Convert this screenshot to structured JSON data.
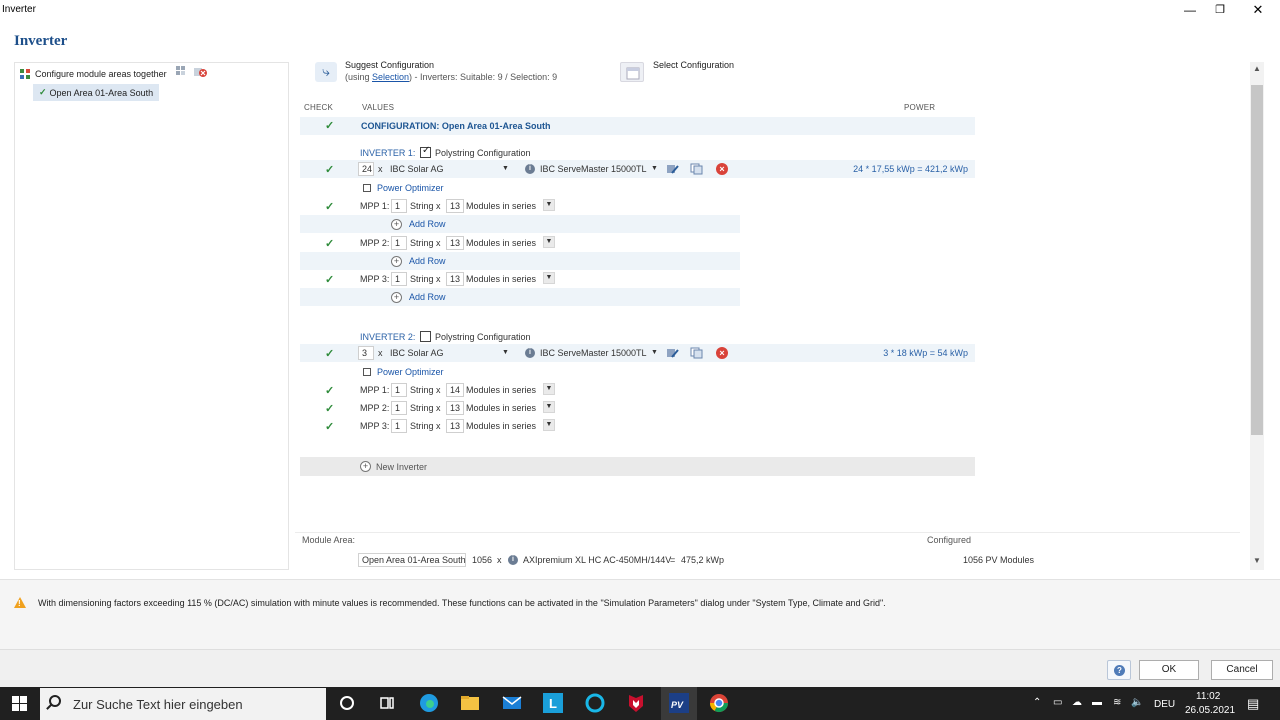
{
  "window": {
    "title": "Inverter",
    "minimize": "—",
    "maximize": "❐",
    "close": "✕"
  },
  "app_title": "Inverter",
  "tree": {
    "root_label": "Configure module areas together",
    "child_label": "Open Area 01-Area South",
    "child_check": "✓"
  },
  "toolbar": {
    "suggest_title": "Suggest Configuration",
    "suggest_prefix": "(using ",
    "suggest_link": "Selection",
    "suggest_suffix": ") - Inverters: Suitable: 9 / Selection: 9",
    "select_title": "Select Configuration"
  },
  "columns": {
    "check": "CHECK",
    "values": "VALUES",
    "power": "POWER"
  },
  "check_mark": "✓",
  "configuration_title": "CONFIGURATION: Open Area 01-Area South",
  "inverters": [
    {
      "label": "INVERTER 1:",
      "polystring_label": "Polystring Configuration",
      "polystring_checked": true,
      "count": "24",
      "times": "x",
      "manufacturer": "IBC Solar AG",
      "model": "IBC ServeMaster 15000TL",
      "power": "24 * 17,55 kWp = 421,2 kWp",
      "power_optimizer": "Power Optimizer",
      "mpps": [
        {
          "label": "MPP 1:",
          "strings": "1",
          "string_x": "String x",
          "modules": "13",
          "suffix": "Modules in series",
          "add_row": "Add Row"
        },
        {
          "label": "MPP 2:",
          "strings": "1",
          "string_x": "String x",
          "modules": "13",
          "suffix": "Modules in series",
          "add_row": "Add Row"
        },
        {
          "label": "MPP 3:",
          "strings": "1",
          "string_x": "String x",
          "modules": "13",
          "suffix": "Modules in series",
          "add_row": "Add Row"
        }
      ]
    },
    {
      "label": "INVERTER 2:",
      "polystring_label": "Polystring Configuration",
      "polystring_checked": false,
      "count": "3",
      "times": "x",
      "manufacturer": "IBC Solar AG",
      "model": "IBC ServeMaster 15000TL",
      "power": "3 * 18 kWp = 54 kWp",
      "power_optimizer": "Power Optimizer",
      "mpps": [
        {
          "label": "MPP 1:",
          "strings": "1",
          "string_x": "String x",
          "modules": "14",
          "suffix": "Modules in series"
        },
        {
          "label": "MPP 2:",
          "strings": "1",
          "string_x": "String x",
          "modules": "13",
          "suffix": "Modules in series"
        },
        {
          "label": "MPP 3:",
          "strings": "1",
          "string_x": "String x",
          "modules": "13",
          "suffix": "Modules in series"
        }
      ]
    }
  ],
  "new_inverter": "New Inverter",
  "summary": {
    "module_area_label": "Module Area:",
    "configured_label": "Configured",
    "area_name": "Open Area 01-Area South",
    "module_count": "1056",
    "times": "x",
    "module_name": "AXIpremium XL HC AC-450MH/144V",
    "equals": "=",
    "total_power": "475,2 kWp",
    "configured_value": "1056 PV Modules"
  },
  "message": "With dimensioning factors exceeding 115 % (DC/AC) simulation with minute values is recommended. These functions can be activated in the \"Simulation Parameters\" dialog under \"System Type, Climate and Grid\".",
  "buttons": {
    "ok": "OK",
    "cancel": "Cancel",
    "help": "?"
  },
  "taskbar": {
    "search_placeholder": "Zur Suche Text hier eingeben",
    "language": "DEU",
    "time": "11:02",
    "date": "26.05.2021",
    "pinned_icons": [
      "cortana-icon",
      "task-view-icon",
      "edge-icon",
      "file-explorer-icon",
      "mail-icon",
      "l-app-icon",
      "alexa-icon",
      "mcafee-icon",
      "pvsol-icon",
      "chrome-icon"
    ]
  },
  "colors": {
    "accent": "#1d4f8a",
    "link": "#1a55a8",
    "check_green": "#2e8b3a",
    "warning": "#f0a11e",
    "error_red": "#d9433a"
  }
}
